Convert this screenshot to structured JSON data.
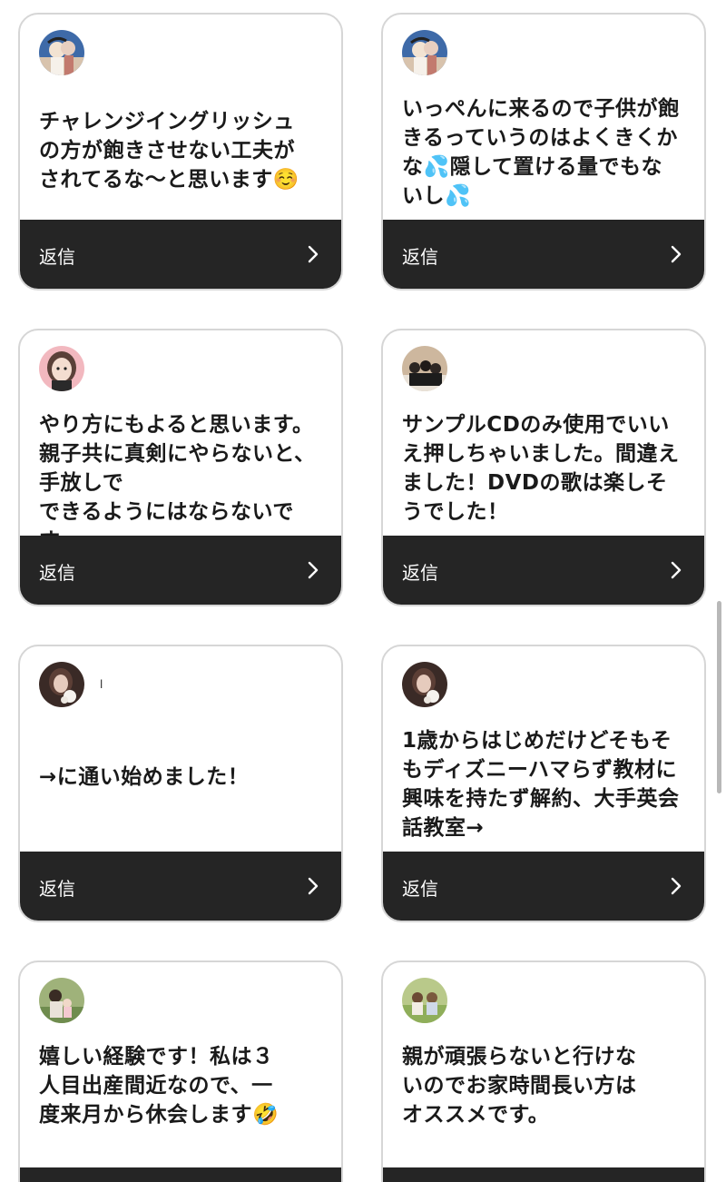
{
  "reply_label": "返信",
  "cards": [
    {
      "avatar": "avatar-photo-woman-kiss",
      "username": "",
      "message": "チャレンジイングリッシュ\nの方が飽きさせない工夫が\nされてるな〜と思います☺️"
    },
    {
      "avatar": "avatar-photo-woman-kiss",
      "username": "",
      "message": "いっぺんに来るので子供が飽\nきるっていうのはよくきくか\nな💦隠して置ける量でもな\nいし💦"
    },
    {
      "avatar": "avatar-illustration-woman",
      "username": "",
      "message": "やり方にもよると思います。\n親子共に真剣にやらないと、\n手放しで\nできるようにはならないです。"
    },
    {
      "avatar": "avatar-photo-group",
      "username": "",
      "message": "サンプルCDのみ使用でいい\nえ押しちゃいました。間違え\nました！DVDの歌は楽しそ\nうでした！"
    },
    {
      "avatar": "avatar-photo-woman-flowers",
      "username": "l",
      "message": "→に通い始めました！"
    },
    {
      "avatar": "avatar-photo-woman-flowers",
      "username": "",
      "message": "1歳からはじめだけどそもそ\nもディズニーハマらず教材に\n興味を持たず解約、大手英会\n話教室→"
    },
    {
      "avatar": "avatar-photo-mother-child-field",
      "username": "",
      "message": "嬉しい経験です！私は３\n人目出産間近なので、一\n度来月から休会します🤣"
    },
    {
      "avatar": "avatar-photo-children-park",
      "username": "",
      "message": "親が頑張らないと行けな\nいのでお家時間長い方は\nオススメです。"
    }
  ],
  "colors": {
    "reply_bar": "#252525",
    "card_border": "#d6d6d6",
    "text": "#1a1a1a"
  }
}
